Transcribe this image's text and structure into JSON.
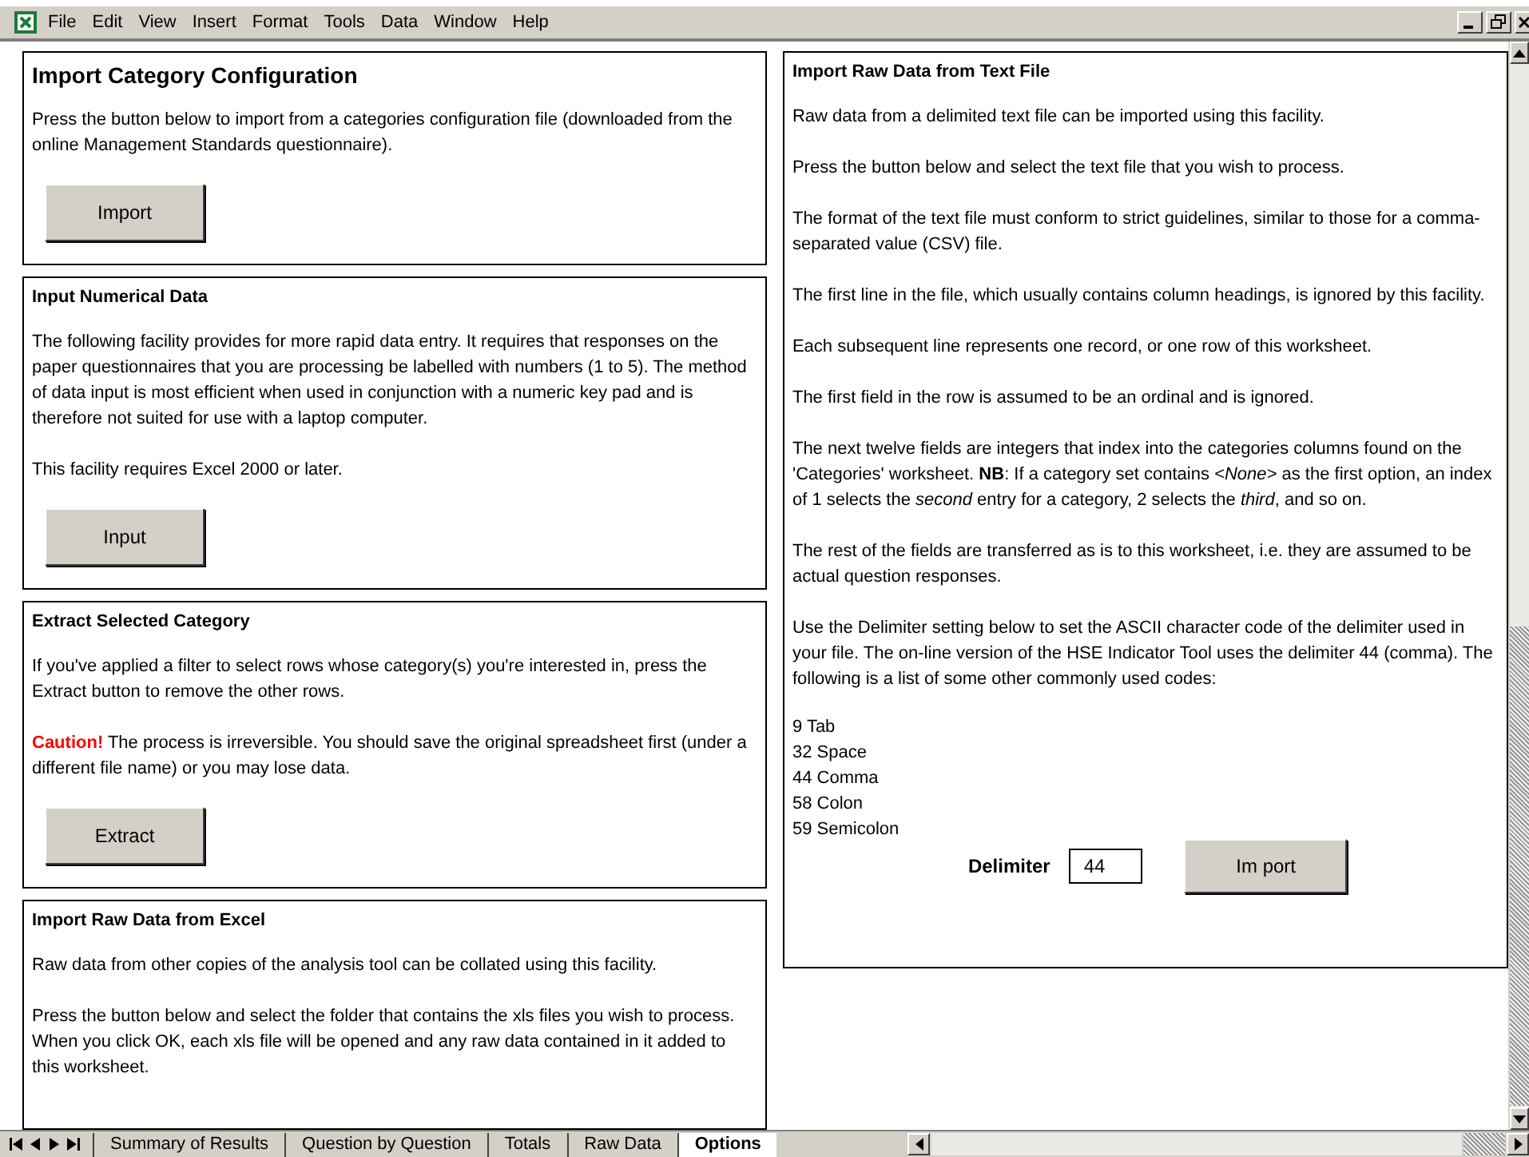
{
  "menu_bar": {
    "items": [
      "File",
      "Edit",
      "View",
      "Insert",
      "Format",
      "Tools",
      "Data",
      "Window",
      "Help"
    ]
  },
  "left_panels": [
    {
      "title": "Import Category Configuration",
      "large_title": true,
      "paragraphs": [
        {
          "kind": "text",
          "text": "Press the button below to import from a categories configuration file (downloaded from the online Management Standards questionnaire)."
        }
      ],
      "button": "Import"
    },
    {
      "title": "Input Numerical Data",
      "large_title": false,
      "paragraphs": [
        {
          "kind": "text",
          "text": "The following facility provides for more rapid data entry. It requires that responses on the paper questionnaires that you are processing be labelled with numbers (1 to 5). The method of data input is most efficient when used in conjunction with a numeric key pad and is therefore not suited for use with a laptop computer."
        },
        {
          "kind": "text",
          "text": "This facility requires Excel 2000 or later."
        }
      ],
      "button": "Input"
    },
    {
      "title": "Extract Selected Category",
      "large_title": false,
      "paragraphs": [
        {
          "kind": "text",
          "text": "If you've applied a filter to select rows whose category(s) you're interested in, press the Extract button to remove the other rows."
        },
        {
          "kind": "warning",
          "warning": "Caution!",
          "text": " The process is irreversible. You should save the original spreadsheet first (under a different file name) or you may lose data."
        }
      ],
      "button": "Extract"
    },
    {
      "title": "Import Raw Data from Excel",
      "large_title": false,
      "paragraphs": [
        {
          "kind": "text",
          "text": "Raw data from other copies of the analysis tool can be collated using this facility."
        },
        {
          "kind": "text",
          "text": "Press the button below and select the folder that contains the xls files you wish to process. When you click OK, each xls file will be opened and any raw data contained in it added to this worksheet."
        }
      ]
    }
  ],
  "right_panel": {
    "title": "Import Raw Data from Text File",
    "paragraphs": [
      "Raw data from a delimited text file can be imported using this facility.",
      "Press the button below and select the text file that you wish to process.",
      "The format of the text file must conform to strict guidelines, similar to those for a comma-separated value (CSV) file.",
      "The first line in the file, which usually contains column headings, is ignored by this facility.",
      "Each subsequent line represents one record, or one row of this worksheet.",
      "The first field in the row is assumed to be an ordinal and is ignored.",
      "The next twelve fields are integers that index into the categories columns found on the 'Categories' worksheet. **NB**: If a category set contains *<None>* as the first option, an index of 1 selects the *second* entry for a category, 2 selects the *third*, and so on.",
      "The rest of the fields are transferred as is to this worksheet, i.e. they are assumed to be actual question responses.",
      "Use the Delimiter setting below to set the ASCII character code of the delimiter used in your file. The on-line version of the HSE Indicator Tool uses the delimiter 44 (comma). The following is a list of some other commonly used codes:"
    ],
    "codes": [
      "9 Tab",
      "32 Space",
      "44 Comma",
      "58 Colon",
      "59 Semicolon"
    ],
    "delimiter_label": "Delimiter",
    "delimiter_value": "44",
    "button": "Im port"
  },
  "sheet_tabs": [
    {
      "label": "Summary of Results",
      "selected": false
    },
    {
      "label": "Question by Question",
      "selected": false
    },
    {
      "label": "Totals",
      "selected": false
    },
    {
      "label": "Raw Data",
      "selected": false
    },
    {
      "label": "Options",
      "selected": true
    }
  ]
}
